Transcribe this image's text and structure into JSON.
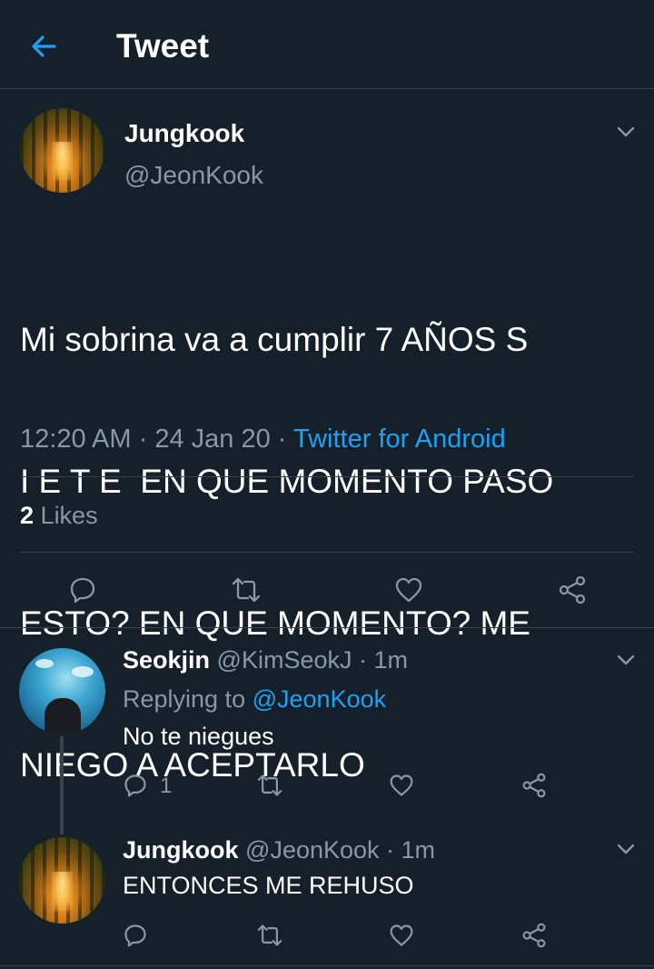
{
  "header": {
    "title": "Tweet",
    "back_icon": "arrow-left-icon",
    "accent_color": "#1da1f2"
  },
  "main_tweet": {
    "display_name": "Jungkook",
    "handle": "@JeonKook",
    "text_lines": [
      "Mi sobrina va a cumplir 7 AÑOS S",
      "I E T E  EN QUE MOMENTO PASO",
      "ESTO? EN QUE MOMENTO? ME",
      "NIEGO A ACEPTARLO"
    ],
    "time": "12:20 AM",
    "date": "24 Jan 20",
    "source": "Twitter for Android",
    "likes_count": "2",
    "likes_label": "Likes",
    "actions": [
      "reply-icon",
      "retweet-icon",
      "like-icon",
      "share-icon"
    ]
  },
  "replies": [
    {
      "display_name": "Seokjin",
      "handle": "@KimSeokJ",
      "time": "· 1m",
      "replying_prefix": "Replying to",
      "replying_to": "@JeonKook",
      "text": "No te niegues",
      "reply_count": "1"
    },
    {
      "display_name": "Jungkook",
      "handle": "@JeonKook",
      "time": "· 1m",
      "text": "ENTONCES ME REHUSO"
    }
  ]
}
